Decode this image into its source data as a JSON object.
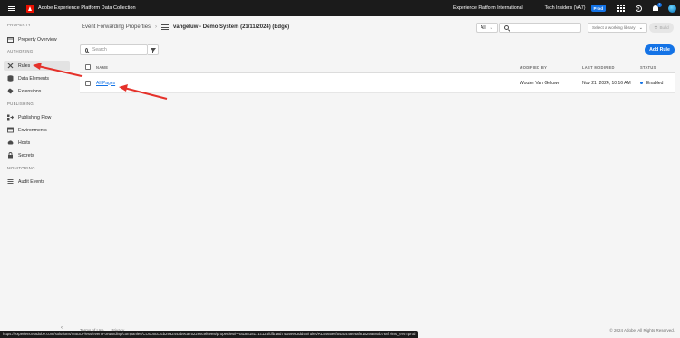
{
  "topbar": {
    "app_title": "Adobe Experience Platform Data Collection",
    "org_name": "Experience Platform International",
    "sandbox_name": "Tech Insiders (VA7)",
    "env_badge": "Prod",
    "notification_count": "1"
  },
  "sidebar": {
    "sections": {
      "property": "PROPERTY",
      "authoring": "AUTHORING",
      "publishing": "PUBLISHING",
      "monitoring": "MONITORING"
    },
    "items": [
      {
        "label": "Property Overview",
        "icon": "property-overview-icon"
      },
      {
        "label": "Rules",
        "icon": "rules-icon",
        "active": true
      },
      {
        "label": "Data Elements",
        "icon": "data-elements-icon"
      },
      {
        "label": "Extensions",
        "icon": "extensions-icon"
      },
      {
        "label": "Publishing Flow",
        "icon": "publishing-flow-icon"
      },
      {
        "label": "Environments",
        "icon": "environments-icon"
      },
      {
        "label": "Hosts",
        "icon": "hosts-icon"
      },
      {
        "label": "Secrets",
        "icon": "secrets-icon"
      },
      {
        "label": "Audit Events",
        "icon": "audit-events-icon"
      }
    ],
    "collapse_glyph": "‹"
  },
  "header": {
    "breadcrumb_root": "Event Forwarding Properties",
    "breadcrumb_sep": "›",
    "property_name": "vangeluw - Demo System (21/11/2024) (Edge)",
    "filter_value": "All",
    "library_placeholder": "Select a working library",
    "build_label": "Build"
  },
  "toolbar": {
    "search_placeholder": "Search",
    "add_rule_label": "Add Rule"
  },
  "table": {
    "columns": {
      "name": "NAME",
      "modified_by": "MODIFIED BY",
      "last_modified": "LAST MODIFIED",
      "status": "STATUS"
    },
    "rows": [
      {
        "name": "All Pages",
        "modified_by": "Wouter Van Geluwe",
        "last_modified": "Nov 21, 2024, 10:16 AM",
        "status": "Enabled"
      }
    ]
  },
  "footer": {
    "terms": "Terms of Use",
    "privacy": "Privacy",
    "copyright": "© 2024 Adobe. All Rights Reserved."
  },
  "statusbar": {
    "url": "https://experience.adobe.com/solutions/reactor-less/eventForwarding/companies/CO0c6cc3cb29a244ab9ca752266c9feee8/properties/PRa18818171c124fdfb18d74a49993dd5b/rules/RL5465ecf54a1448e3af81629a580b7a8f?ims_env=prod"
  },
  "colors": {
    "accent": "#1473e6",
    "annotation_arrow": "#e5312a",
    "topbar_bg": "#1b1b1b"
  }
}
